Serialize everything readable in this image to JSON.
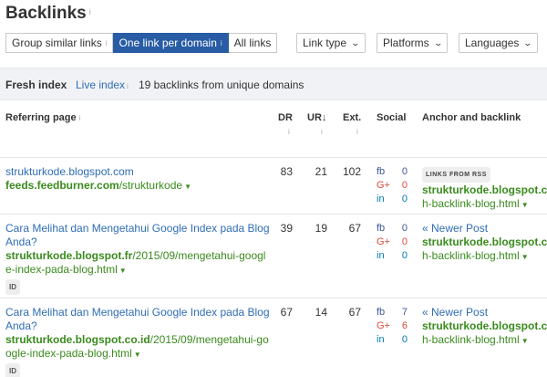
{
  "page": {
    "title": "Backlinks",
    "title_info": "i"
  },
  "toolbar": {
    "group_similar": "Group similar links",
    "one_link": "One link per domain",
    "all_links": "All links",
    "link_type": "Link type",
    "platforms": "Platforms",
    "languages": "Languages",
    "info_glyph": "i"
  },
  "index_bar": {
    "fresh_index": "Fresh index",
    "live_index": "Live index",
    "summary": "19 backlinks from unique domains"
  },
  "table": {
    "headers": {
      "referring_page": "Referring page",
      "dr": "DR",
      "ur": "UR",
      "ur_sort": "↓",
      "ext": "Ext.",
      "social": "Social",
      "anchor": "Anchor and backlink"
    },
    "rows": [
      {
        "title": "strukturkode.blogspot.com",
        "url_domain": "feeds.feedburner.com",
        "url_path": "/strukturkode",
        "tag": "",
        "dr": "83",
        "ur": "21",
        "ext": "102",
        "fb": "0",
        "gp": "0",
        "in": "0",
        "anchor_label": "LINKS FROM RSS",
        "anchor_domain": "strukturkode.blogspot.co",
        "anchor_path": "h-backlink-blog.html"
      },
      {
        "title": "Cara Melihat dan Mengetahui Google Index pada Blog Anda?",
        "url_domain": "strukturkode.blogspot.fr",
        "url_path": "/2015/09/mengetahui-google-index-pada-blog.html",
        "tag": "ID",
        "dr": "39",
        "ur": "19",
        "ext": "67",
        "fb": "0",
        "gp": "0",
        "in": "0",
        "anchor_label": "« Newer Post",
        "anchor_domain": "strukturkode.blogspot.co",
        "anchor_path": "h-backlink-blog.html"
      },
      {
        "title": "Cara Melihat dan Mengetahui Google Index pada Blog Anda?",
        "url_domain": "strukturkode.blogspot.co.id",
        "url_path": "/2015/09/mengetahui-google-index-pada-blog.html",
        "tag": "ID",
        "dr": "67",
        "ur": "14",
        "ext": "67",
        "fb": "7",
        "gp": "6",
        "in": "0",
        "anchor_label": "« Newer Post",
        "anchor_domain": "strukturkode.blogspot.co",
        "anchor_path": "h-backlink-blog.html"
      }
    ]
  },
  "social_labels": {
    "fb": "fb",
    "gp": "G+",
    "in": "in"
  }
}
